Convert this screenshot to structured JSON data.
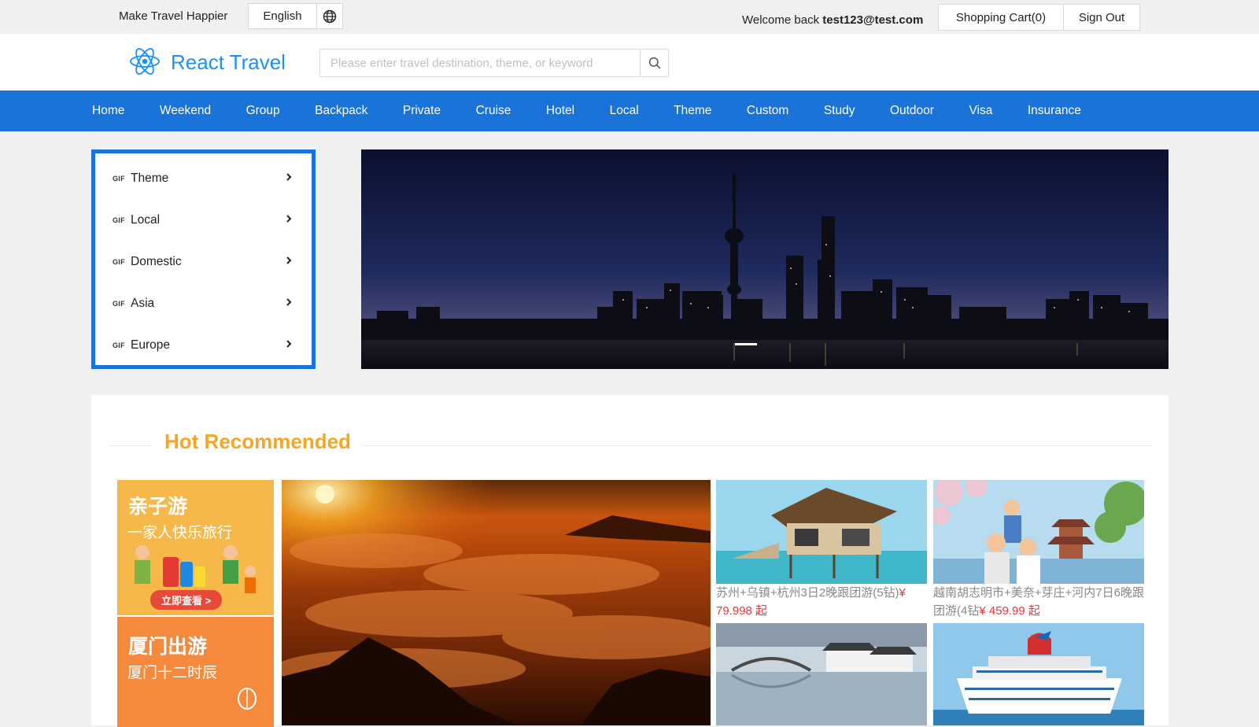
{
  "topbar": {
    "slogan": "Make Travel Happier",
    "language": "English",
    "welcome_prefix": "Welcome back",
    "username": "test123@test.com",
    "cart_label": "Shopping Cart(0)",
    "signout_label": "Sign Out"
  },
  "header": {
    "brand": "React Travel",
    "search_placeholder": "Please enter travel destination, theme, or keyword"
  },
  "nav": {
    "items": [
      "Home",
      "Weekend",
      "Group",
      "Backpack",
      "Private",
      "Cruise",
      "Hotel",
      "Local",
      "Theme",
      "Custom",
      "Study",
      "Outdoor",
      "Visa",
      "Insurance"
    ]
  },
  "sidemenu": {
    "badge": "GIF",
    "items": [
      "Theme",
      "Local",
      "Domestic",
      "Asia",
      "Europe"
    ]
  },
  "recommended": {
    "title": "Hot Recommended",
    "promo1": {
      "title": "亲子游",
      "subtitle": "一家人快乐旅行",
      "button": "立即查看 >"
    },
    "promo2": {
      "title": "厦门出游",
      "subtitle": "厦门十二时辰"
    },
    "products": [
      {
        "name": "苏州+乌镇+杭州3日2晚跟团游(5钻)",
        "price": "¥ 79.998 起"
      },
      {
        "name": "越南胡志明市+美奈+芽庄+河内7日6晚跟团游(4钻",
        "price": "¥ 459.99 起"
      }
    ]
  },
  "colors": {
    "brand_blue": "#1a73d9",
    "accent_orange": "#f5a623",
    "price_red": "#e8363a"
  }
}
